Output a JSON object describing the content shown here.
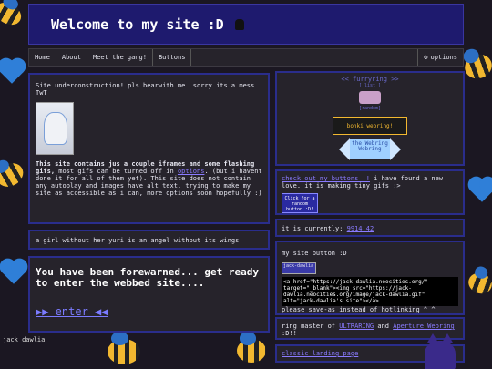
{
  "header": {
    "title": "Welcome to my site :D"
  },
  "nav": {
    "items": [
      "Home",
      "About",
      "Meet the gang!",
      "Buttons"
    ],
    "options_label": "options",
    "options_icon": "gear-icon"
  },
  "intro": {
    "notice": "Site underconstruction! pls bearwith me. sorry its a mess TwT",
    "warning_bold": "This site contains jus a couple iframes and some flashing gifs,",
    "warning_rest_1": " most gifs can be turned off in ",
    "warning_link": "options",
    "warning_rest_2": ". (but i havent done it for all of them yet). This site does not contain any autoplay and images have alt text. trying to make my site as accessible as i can, more options soon hopefully :)"
  },
  "quote": "a girl without her yuri is an angel without its wings",
  "forewarn": {
    "text": "You have been forewarned... get ready to enter the webbed site....",
    "enter": "▶▶ enter ◀◀"
  },
  "webring": {
    "title": "furryring",
    "left_arrow": "<<",
    "right_arrow": ">>",
    "list_label": "[ list ]",
    "random_label": "[random]",
    "bonk_label": "bonki webring!",
    "webring_label": "the Webring Webring"
  },
  "buttons_box": {
    "link": "check out my buttons !!",
    "text": " i have found a new love. it is making tiny gifs :>",
    "random_button": "Click for a random button :D!"
  },
  "clock": {
    "label": "it is currently: ",
    "value": "9914.42"
  },
  "site_button": {
    "heading": "my site button :D",
    "button_text": "jack-dawlia",
    "code": "<a href=\"https://jack-dawlia.neocities.org/\" target=\"_blank\"><img src=\"https://jack-dawlia.neocities.org/image/jack-dawlia.gif\" alt=\"jack-dawlia's site\"></a>",
    "note": "please save-as instead of hotlinking ^_^"
  },
  "ringmaster": {
    "prefix": "ring master of ",
    "ring1": "ULTRARING",
    "middle": " and ",
    "ring2": "Aperture Webring",
    "suffix": " :D!!"
  },
  "classic": {
    "link": "classic landing page"
  },
  "signature": "jack_dawlia"
}
